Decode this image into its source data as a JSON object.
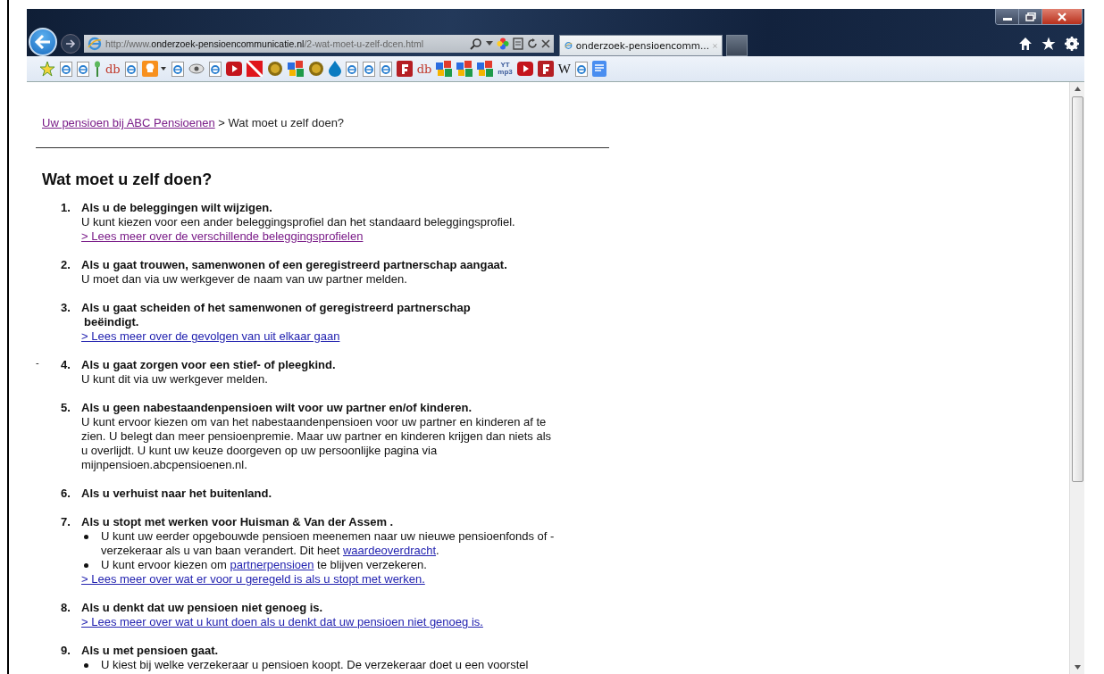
{
  "browser": {
    "address": {
      "prefix": "http://www.",
      "domain": "onderzoek-pensioencommunicatie.nl",
      "path": "/2-wat-moet-u-zelf-dcen.html"
    },
    "tabs": [
      {
        "title": "onderzoek-pensioencomm...",
        "selected": true
      }
    ],
    "favorites": [
      {
        "kind": "star"
      },
      {
        "kind": "page"
      },
      {
        "kind": "page"
      },
      {
        "kind": "plant"
      },
      {
        "kind": "text",
        "label": "db"
      },
      {
        "kind": "page"
      },
      {
        "kind": "bulb"
      },
      {
        "kind": "page"
      },
      {
        "kind": "eye"
      },
      {
        "kind": "page"
      },
      {
        "kind": "play"
      },
      {
        "kind": "flag"
      },
      {
        "kind": "coin"
      },
      {
        "kind": "blocks"
      },
      {
        "kind": "coin"
      },
      {
        "kind": "drop"
      },
      {
        "kind": "page"
      },
      {
        "kind": "page"
      },
      {
        "kind": "page"
      },
      {
        "kind": "redapp"
      },
      {
        "kind": "text",
        "label": "db"
      },
      {
        "kind": "blocks"
      },
      {
        "kind": "blocks"
      },
      {
        "kind": "blocks"
      },
      {
        "kind": "mp3",
        "label": "YT",
        "sublabel": "mp3"
      },
      {
        "kind": "play"
      },
      {
        "kind": "redapp"
      },
      {
        "kind": "wiki",
        "label": "W"
      },
      {
        "kind": "page"
      },
      {
        "kind": "doc"
      }
    ]
  },
  "page": {
    "breadcrumb": {
      "link": "Uw pensioen bij  ABC Pensioenen",
      "visited": true,
      "rest": " > Wat moet u zelf doen?"
    },
    "heading": "Wat moet u zelf doen?",
    "items": [
      {
        "number": "1.",
        "title_lines": [
          "Als u de beleggingen wilt wijzigen."
        ],
        "body": [
          {
            "text": "U kunt kiezen voor een ander beleggingsprofiel dan het standaard beleggingsprofiel."
          }
        ],
        "links": [
          {
            "text": "> Lees meer over de verschillende beleggingsprofielen",
            "visited": true
          }
        ]
      },
      {
        "number": "2.",
        "title_lines": [
          "Als u gaat trouwen, samenwonen of een geregistreerd partnerschap aangaat."
        ],
        "body": [
          {
            "text": "U moet dan via uw werkgever de naam van uw partner melden."
          }
        ]
      },
      {
        "number": "3.",
        "title_lines": [
          "Als u gaat scheiden of het samenwonen of geregistreerd partnerschap",
          "beëindigt."
        ],
        "links": [
          {
            "text": "> Lees meer over de gevolgen van uit elkaar gaan",
            "visited": false
          }
        ]
      },
      {
        "number": "4.",
        "mark": "-",
        "title_lines": [
          "Als u gaat zorgen voor een stief- of pleegkind."
        ],
        "body": [
          {
            "text": "U kunt dit via uw werkgever melden."
          }
        ]
      },
      {
        "number": "5.",
        "title_lines": [
          "Als u geen nabestaandenpensioen wilt voor uw partner en/of kinderen."
        ],
        "body": [
          {
            "text": "U kunt ervoor kiezen om van het nabestaandenpensioen voor uw partner en kinderen af te zien. U belegt dan meer pensioenpremie. Maar uw partner en kinderen krijgen dan niets als u overlijdt. U kunt uw keuze doorgeven op uw persoonlijke pagina via mijnpensioen.abcpensioenen.nl."
          }
        ]
      },
      {
        "number": "6.",
        "title_lines": [
          "Als u verhuist naar het buitenland."
        ]
      },
      {
        "number": "7.",
        "title_lines": [
          "Als u stopt met werken voor Huisman & Van der Assem ."
        ],
        "bullets": [
          [
            {
              "text": "U kunt uw eerder opgebouwde pensioen meenemen naar uw nieuwe pensioenfonds of -verzekeraar als u van baan verandert. Dit heet "
            },
            {
              "link": "waardeoverdracht"
            },
            {
              "text": "."
            }
          ],
          [
            {
              "text": "U kunt ervoor kiezen om "
            },
            {
              "link": "partnerpensioen"
            },
            {
              "text": " te blijven verzekeren."
            }
          ]
        ],
        "links": [
          {
            "text": "> Lees meer over wat er voor u geregeld is als u stopt met werken.",
            "visited": false
          }
        ]
      },
      {
        "number": "8.",
        "title_lines": [
          "Als u denkt dat uw pensioen niet genoeg is."
        ],
        "links": [
          {
            "text": "> Lees meer over wat u kunt doen als u denkt dat uw pensioen niet genoeg is.",
            "visited": false
          }
        ]
      },
      {
        "number": "9.",
        "title_lines": [
          "Als u met pensioen gaat."
        ],
        "bullets": [
          [
            {
              "text": "U kiest bij welke verzekeraar u pensioen koopt. De verzekeraar doet u een voorstel"
            }
          ]
        ]
      }
    ]
  }
}
